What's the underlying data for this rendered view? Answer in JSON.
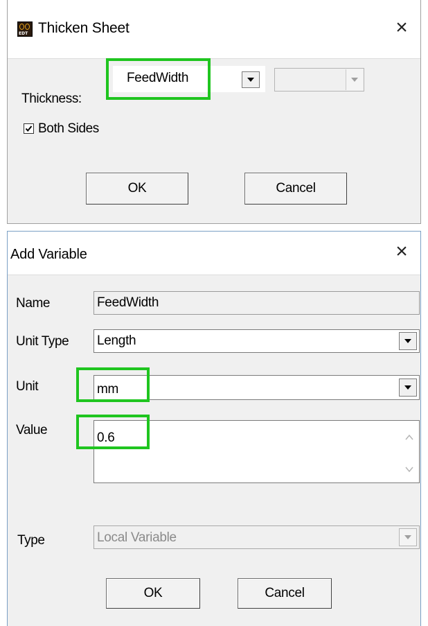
{
  "thicken_dialog": {
    "title": "Thicken Sheet",
    "close_glyph": "×",
    "app_icon": "edt-app-icon",
    "app_icon_text": "EDT",
    "thickness_label": "Thickness:",
    "thickness_value": "FeedWidth",
    "both_sides_label": "Both Sides",
    "both_sides_checked": true,
    "ok_label": "OK",
    "cancel_label": "Cancel"
  },
  "add_variable_dialog": {
    "title": "Add Variable",
    "close_glyph": "×",
    "name_label": "Name",
    "name_value": "FeedWidth",
    "unit_type_label": "Unit Type",
    "unit_type_value": "Length",
    "unit_label": "Unit",
    "unit_value": "mm",
    "value_label": "Value",
    "value_value": "0.6",
    "type_label": "Type",
    "type_value": "Local Variable",
    "ok_label": "OK",
    "cancel_label": "Cancel"
  },
  "highlight_color": "#1fc51f"
}
